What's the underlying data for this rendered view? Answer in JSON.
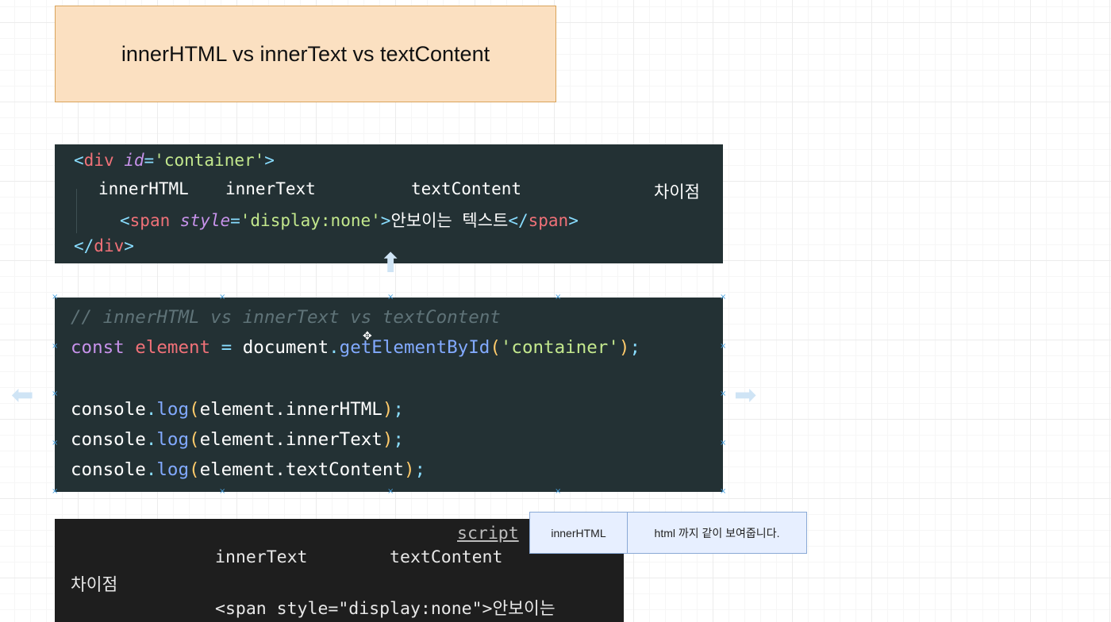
{
  "title": "innerHTML vs innerText vs textContent",
  "html_snippet": {
    "line1": {
      "open": "<",
      "tag": "div",
      "attr": "id",
      "eq": "=",
      "value": "'container'",
      "close": ">"
    },
    "line2": {
      "words": [
        "innerHTML",
        "innerText",
        "textContent",
        "차이점"
      ]
    },
    "line3": {
      "open": "<",
      "tag": "span",
      "attr": "style",
      "eq": "=",
      "value": "'display:none'",
      "close": ">",
      "text": "안보이는 텍스트",
      "end_open": "</",
      "end_tag": "span",
      "end_close": ">"
    },
    "line4": {
      "open": "</",
      "tag": "div",
      "close": ">"
    }
  },
  "js_snippet": {
    "comment": "// innerHTML vs innerText vs textContent",
    "declaration": {
      "keyword": "const",
      "var": "element",
      "op": "=",
      "object": "document",
      "dot": ".",
      "method": "getElementById",
      "paren_open": "(",
      "arg": "'container'",
      "paren_close": ")",
      "semi": ";"
    },
    "logs": [
      {
        "object": "console",
        "method": "log",
        "arg": "element.innerHTML"
      },
      {
        "object": "console",
        "method": "log",
        "arg": "element.innerText"
      },
      {
        "object": "console",
        "method": "log",
        "arg": "element.textContent"
      }
    ],
    "dot": ".",
    "paren_open": "(",
    "paren_close": ")",
    "semi": ";"
  },
  "output_panel": {
    "script_label": "script",
    "line1": "innerText        textContent",
    "line2": "차이점",
    "line3": "<span style=\"display:none\">안보이는"
  },
  "tooltip": {
    "label": "innerHTML",
    "description": "html 까지 같이 보여줍니다."
  },
  "colors": {
    "title_bg": "#fbe0c1",
    "code_bg": "#233134",
    "tag": "#f07178",
    "attr": "#c792ea",
    "string": "#c3e88d",
    "function": "#82aaff",
    "paren": "#ffcb6b",
    "selection_handle": "#4aa3e0"
  }
}
